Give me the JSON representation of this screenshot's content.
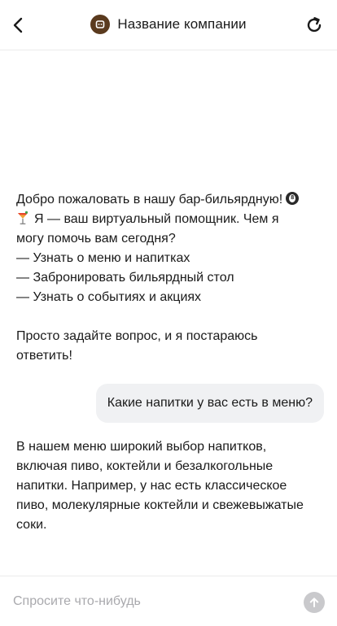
{
  "header": {
    "title": "Название компании",
    "back_icon": "chevron-left-icon",
    "refresh_icon": "refresh-icon",
    "logo_icon": "company-logo-icon"
  },
  "messages": [
    {
      "role": "bot",
      "lines": [
        "Добро пожаловать в нашу бар-бильярдную!",
        "Я — ваш виртуальный помощник. Чем я",
        "могу помочь вам сегодня?",
        "— Узнать о меню и напитках",
        "— Забронировать бильярдный стол",
        "— Узнать о событиях и акциях",
        "",
        "Просто задайте вопрос, и я постараюсь",
        "ответить!"
      ],
      "emojis": [
        "billiard-ball-icon",
        "cocktail-icon"
      ]
    },
    {
      "role": "user",
      "text": "Какие напитки у вас есть в меню?"
    },
    {
      "role": "bot",
      "lines": [
        "В нашем меню широкий выбор напитков,",
        "включая пиво, коктейли и безалкогольные",
        "напитки. Например, у нас есть классическое",
        "пиво, молекулярные коктейли и свежевыжатые",
        "соки."
      ]
    }
  ],
  "input": {
    "placeholder": "Спросите что-нибудь",
    "value": "",
    "send_icon": "arrow-up-icon"
  },
  "colors": {
    "logo_bg": "#5a3a1e",
    "user_bubble_bg": "#f0f1f3",
    "send_button_bg": "#c9c9cc",
    "placeholder": "#a9a9ad"
  }
}
